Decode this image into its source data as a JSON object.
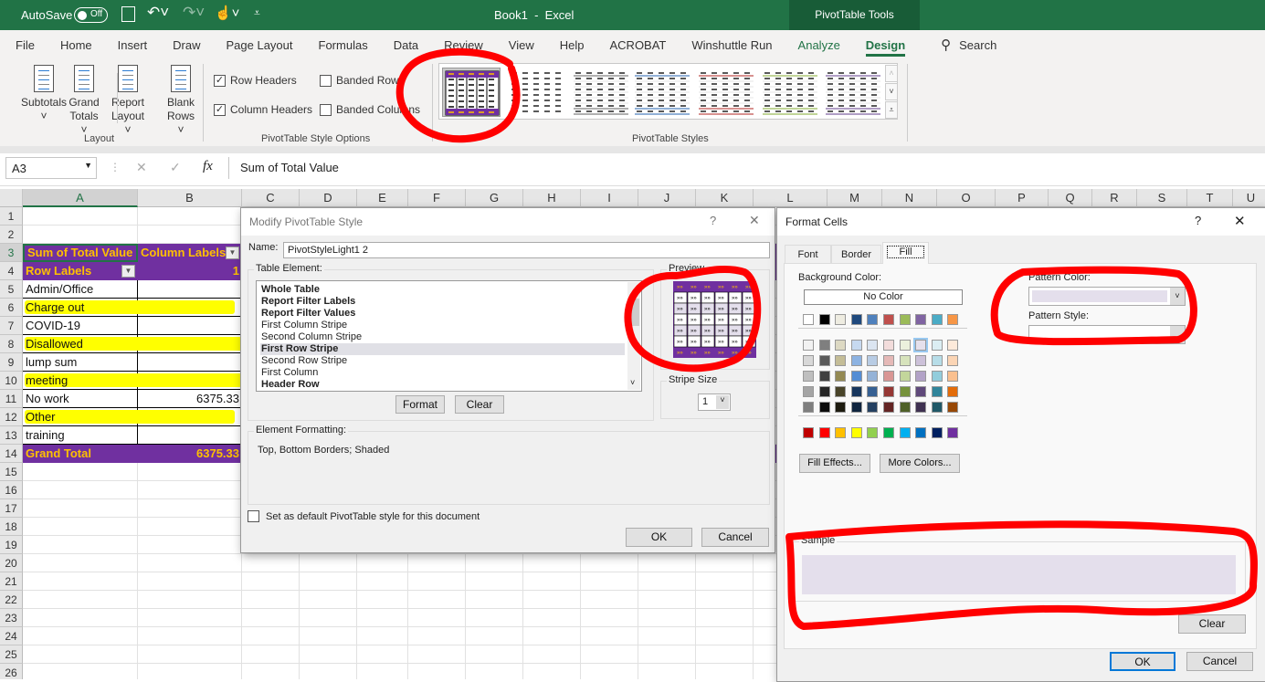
{
  "titlebar": {
    "autosave_label": "AutoSave",
    "autosave_state": "Off",
    "title": "Book1  -  Excel",
    "context_tab": "PivotTable Tools"
  },
  "tabs": [
    {
      "label": "File"
    },
    {
      "label": "Home"
    },
    {
      "label": "Insert"
    },
    {
      "label": "Draw"
    },
    {
      "label": "Page Layout"
    },
    {
      "label": "Formulas"
    },
    {
      "label": "Data"
    },
    {
      "label": "Review"
    },
    {
      "label": "View"
    },
    {
      "label": "Help"
    },
    {
      "label": "ACROBAT"
    },
    {
      "label": "Winshuttle Run"
    },
    {
      "label": "Analyze",
      "state": "context"
    },
    {
      "label": "Design",
      "state": "active"
    }
  ],
  "search": {
    "label": "Search",
    "icon": "search-icon"
  },
  "ribbon": {
    "layout": {
      "group": "Layout",
      "buttons": [
        {
          "line1": "Subtotals",
          "line2": "˅"
        },
        {
          "line1": "Grand",
          "line2": "Totals ˅"
        },
        {
          "line1": "Report",
          "line2": "Layout ˅"
        },
        {
          "line1": "Blank",
          "line2": "Rows ˅"
        }
      ]
    },
    "options": {
      "group": "PivotTable Style Options",
      "checks": [
        {
          "label": "Row Headers",
          "checked": true
        },
        {
          "label": "Banded Rows",
          "checked": false
        },
        {
          "label": "Column Headers",
          "checked": true
        },
        {
          "label": "Banded Columns",
          "checked": false
        }
      ]
    },
    "styles": {
      "group": "PivotTable Styles",
      "thumb_colors": [
        "#7030a0",
        "#000000",
        "#808080",
        "#4f81bd",
        "#c0504d",
        "#9bbb59",
        "#8064a2"
      ]
    }
  },
  "formula_bar": {
    "name_box": "A3",
    "cancel": "✕",
    "enter": "✓",
    "fx": "fx",
    "formula": "Sum of Total Value"
  },
  "sheet": {
    "columns": [
      "A",
      "B",
      "C",
      "D",
      "E",
      "F",
      "G",
      "H",
      "I",
      "J",
      "K",
      "L",
      "M",
      "N",
      "O",
      "P",
      "Q",
      "R",
      "S",
      "T",
      "U"
    ],
    "row_count": 26,
    "pivot_color": "#7030a0",
    "pivot_text_color": "#ffc000",
    "highlight_color": "#ffff00",
    "rows": [
      {
        "row": 3,
        "a": "Sum of Total Value",
        "b": "Column Labels",
        "kind": "header",
        "filter_b": true
      },
      {
        "row": 4,
        "a": "Row Labels",
        "b": "1",
        "kind": "header",
        "filter_a": true
      },
      {
        "row": 5,
        "a": "Admin/Office",
        "b": "",
        "kind": "item"
      },
      {
        "row": 6,
        "a": "Charge out",
        "b": "",
        "kind": "item",
        "highlight": true
      },
      {
        "row": 7,
        "a": "COVID-19",
        "b": "",
        "kind": "item"
      },
      {
        "row": 8,
        "a": "Disallowed",
        "b": "",
        "kind": "item",
        "highlight": true
      },
      {
        "row": 9,
        "a": "lump sum",
        "b": "",
        "kind": "item"
      },
      {
        "row": 10,
        "a": "meeting",
        "b": "",
        "kind": "item",
        "highlight": true
      },
      {
        "row": 11,
        "a": "No work",
        "b": "6375.33",
        "kind": "item"
      },
      {
        "row": 12,
        "a": "Other",
        "b": "",
        "kind": "item",
        "highlight": true
      },
      {
        "row": 13,
        "a": "training",
        "b": "",
        "kind": "item"
      },
      {
        "row": 14,
        "a": "Grand Total",
        "b": "6375.33",
        "kind": "total"
      }
    ]
  },
  "modify_dialog": {
    "title": "Modify PivotTable Style",
    "help": "?",
    "close": "✕",
    "name_label": "Name:",
    "name_value": "PivotStyleLight1 2",
    "table_element_label": "Table Element:",
    "elements": [
      {
        "label": "Whole Table",
        "bold": true
      },
      {
        "label": "Report Filter Labels",
        "bold": true
      },
      {
        "label": "Report Filter Values",
        "bold": true
      },
      {
        "label": "First Column Stripe"
      },
      {
        "label": "Second Column Stripe"
      },
      {
        "label": "First Row Stripe",
        "bold": true,
        "selected": true
      },
      {
        "label": "Second Row Stripe"
      },
      {
        "label": "First Column"
      },
      {
        "label": "Header Row",
        "bold": true
      }
    ],
    "format_button": "Format",
    "clear_button": "Clear",
    "preview_label": "Preview",
    "stripe_size_label": "Stripe Size",
    "stripe_size": "1",
    "element_formatting_label": "Element Formatting:",
    "element_formatting": "Top, Bottom Borders; Shaded",
    "default_checkbox": {
      "label": "Set as default PivotTable style for this document",
      "checked": false
    },
    "ok": "OK",
    "cancel": "Cancel"
  },
  "format_cells": {
    "title": "Format Cells",
    "help": "?",
    "close": "✕",
    "tabs": [
      {
        "label": "Font"
      },
      {
        "label": "Border"
      },
      {
        "label": "Fill",
        "active": true
      }
    ],
    "background_color_label": "Background Color:",
    "no_color": "No Color",
    "theme_colors": [
      "#ffffff",
      "#000000",
      "#eeece1",
      "#1f497d",
      "#4f81bd",
      "#c0504d",
      "#9bbb59",
      "#8064a2",
      "#4bacc6",
      "#f79646"
    ],
    "tints": [
      [
        "#f2f2f2",
        "#7f7f7f",
        "#ddd9c3",
        "#c6d9f0",
        "#dbe5f1",
        "#f2dcdb",
        "#ebf1dd",
        "#e5e0ec",
        "#dbeef3",
        "#fdeada"
      ],
      [
        "#d8d8d8",
        "#595959",
        "#c4bd97",
        "#8db3e2",
        "#b8cce4",
        "#e5b9b7",
        "#d7e3bc",
        "#ccc1d9",
        "#b7dde8",
        "#fbd5b5"
      ],
      [
        "#bfbfbf",
        "#3f3f3f",
        "#938953",
        "#548dd4",
        "#95b3d7",
        "#d99694",
        "#c3d69b",
        "#b2a2c7",
        "#92cddc",
        "#fac08f"
      ],
      [
        "#a5a5a5",
        "#262626",
        "#494429",
        "#17365d",
        "#366092",
        "#953734",
        "#76923c",
        "#5f497a",
        "#31859b",
        "#e36c09"
      ],
      [
        "#7f7f7f",
        "#0c0c0c",
        "#1d1b10",
        "#0f243e",
        "#244061",
        "#632423",
        "#4f6128",
        "#3f3151",
        "#205867",
        "#974806"
      ]
    ],
    "selected_tint": "#e5e0ec",
    "standard_colors": [
      "#c00000",
      "#ff0000",
      "#ffc000",
      "#ffff00",
      "#92d050",
      "#00b050",
      "#00b0f0",
      "#0070c0",
      "#002060",
      "#7030a0"
    ],
    "fill_effects": "Fill Effects...",
    "more_colors": "More Colors...",
    "pattern_color_label": "Pattern Color:",
    "pattern_color": "#e4dfec",
    "pattern_style_label": "Pattern Style:",
    "sample_label": "Sample",
    "sample_color": "#e4dfec",
    "clear": "Clear",
    "ok": "OK",
    "cancel": "Cancel"
  },
  "annotation_color": "#ff0000"
}
